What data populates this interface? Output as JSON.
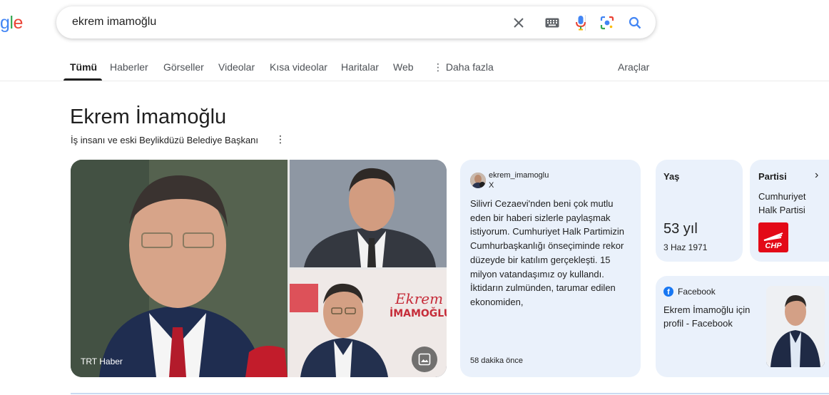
{
  "logo": {
    "p1": "g",
    "p2": "l",
    "p3": "e"
  },
  "search": {
    "query": "ekrem imamoğlu"
  },
  "tabs": [
    {
      "label": "Tümü"
    },
    {
      "label": "Haberler"
    },
    {
      "label": "Görseller"
    },
    {
      "label": "Videolar"
    },
    {
      "label": "Kısa videolar"
    },
    {
      "label": "Haritalar"
    },
    {
      "label": "Web"
    },
    {
      "label": "Daha fazla"
    }
  ],
  "tools_label": "Araçlar",
  "knowledge_panel": {
    "title": "Ekrem İmamoğlu",
    "subtitle": "İş insanı ve eski Beylikdüzü Belediye Başkanı",
    "image_caption": "TRT Haber",
    "poster_text": {
      "line1": "Ekrem",
      "line2": "İMAMOĞLU"
    },
    "tweet": {
      "handle": "ekrem_imamoglu",
      "source": "X",
      "text": "Silivri Cezaevi'nden beni çok mutlu eden bir haberi sizlerle paylaşmak istiyorum. Cumhuriyet Halk Partimizin Cumhurbaşkanlığı önseçiminde rekor düzeyde bir katılım gerçekleşti. 15 milyon vatandaşımız oy kullandı. İktidarın zulmünden, tarumar edilen ekonomiden,",
      "time": "58 dakika önce"
    },
    "age": {
      "label": "Yaş",
      "value": "53 yıl",
      "birth_date": "3 Haz 1971"
    },
    "party": {
      "label": "Partisi",
      "name": "Cumhuriyet Halk Partisi",
      "logo_text": "CHP"
    },
    "facebook": {
      "source": "Facebook",
      "text": "Ekrem İmamoğlu için profil - Facebook"
    }
  },
  "colors": {
    "accent_blue": "#1a73e8",
    "card_bg": "#eaf1fb",
    "chp_red": "#e30a17",
    "facebook_blue": "#1877f2"
  }
}
